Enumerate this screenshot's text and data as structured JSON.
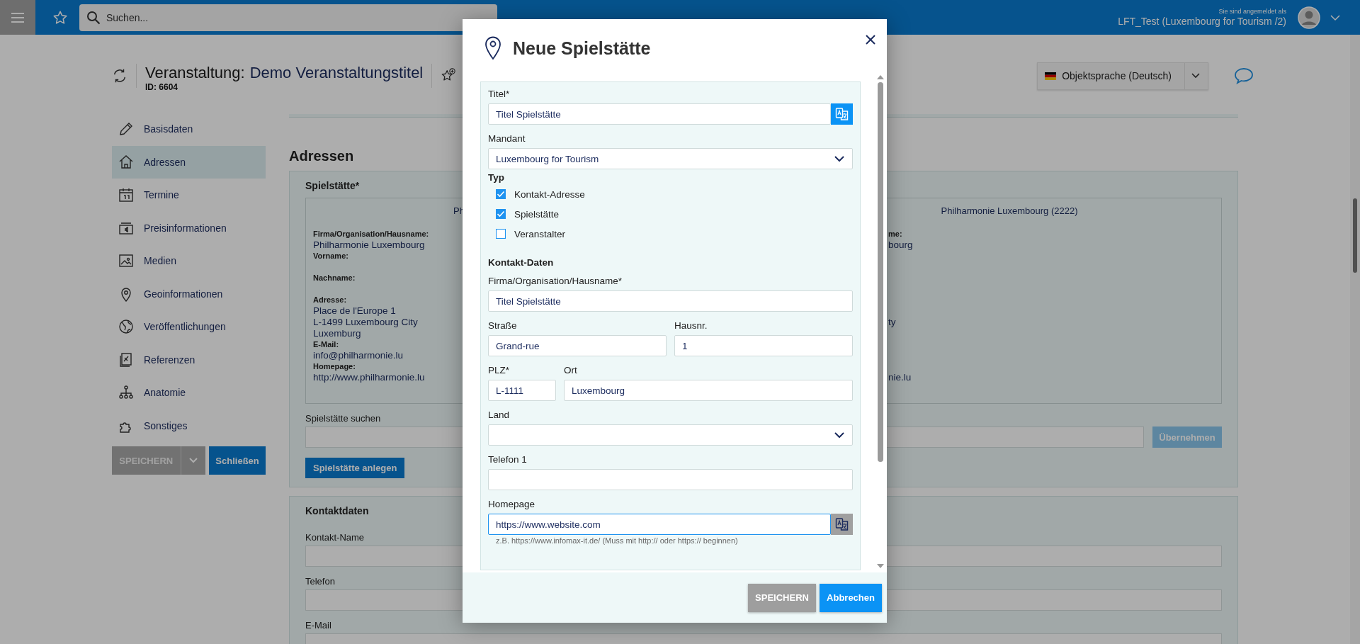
{
  "topbar": {
    "search": {
      "placeholder": "Suchen..."
    },
    "user": {
      "caption": "Sie sind angemeldet als",
      "name": "LFT_Test (Luxembourg for Tourism /2)"
    }
  },
  "header": {
    "prefix": "Veranstaltung:",
    "title": "Demo Veranstaltungstitel",
    "id": "ID: 6604",
    "language": "Objektsprache (Deutsch)"
  },
  "sidebar": {
    "items": [
      {
        "label": "Basisdaten",
        "selected": false
      },
      {
        "label": "Adressen",
        "selected": true
      },
      {
        "label": "Termine",
        "selected": false
      },
      {
        "label": "Preisinformationen",
        "selected": false
      },
      {
        "label": "Medien",
        "selected": false
      },
      {
        "label": "Geoinformationen",
        "selected": false
      },
      {
        "label": "Veröffentlichungen",
        "selected": false
      },
      {
        "label": "Referenzen",
        "selected": false
      },
      {
        "label": "Anatomie",
        "selected": false
      },
      {
        "label": "Sonstiges",
        "selected": false
      }
    ],
    "save": "SPEICHERN",
    "close": "Schließen"
  },
  "main": {
    "heading": "Adressen",
    "venue": {
      "title": "Spielstätte*",
      "left_header": "Ph",
      "right_header": "Philharmonie Luxembourg (2222)",
      "left": [
        {
          "label": "Firma/Organisation/Hausname:",
          "lines": [
            "Philharmonie Luxembourg"
          ]
        },
        {
          "label": "Vorname:"
        },
        {
          "label": "Nachname:"
        },
        {
          "label": "Adresse:",
          "lines": [
            "Place de l'Europe 1",
            "L-1499 Luxembourg City",
            "Luxemburg"
          ]
        },
        {
          "label": "E-Mail:",
          "lines": [
            "info@philharmonie.lu"
          ]
        },
        {
          "label": "Homepage:",
          "lines": [
            "http://www.philharmonie.lu"
          ]
        }
      ],
      "right": [
        {
          "label": "me:",
          "lines": [
            "bourg"
          ]
        },
        {
          "lines": [
            "ty"
          ]
        },
        {
          "lines": [
            "nie.lu"
          ]
        }
      ],
      "search_label": "Spielstätte suchen",
      "apply": {
        "label": "Übernehmen",
        "disabled": true
      },
      "create": "Spielstätte anlegen"
    },
    "contact": {
      "title": "Kontaktdaten",
      "fields": [
        "Kontakt-Name",
        "Telefon",
        "E-Mail"
      ]
    }
  },
  "modal": {
    "title": "Neue Spielstätte",
    "form": [
      {
        "kind": "text",
        "label": "Titel*",
        "value": "Titel Spielstätte",
        "translate": {
          "active": true
        }
      },
      {
        "kind": "select",
        "label": "Mandant",
        "value": "Luxembourg for Tourism"
      },
      {
        "kind": "checks",
        "label": "Typ",
        "options": [
          {
            "label": "Kontakt-Adresse",
            "checked": true
          },
          {
            "label": "Spielstätte",
            "checked": true
          },
          {
            "label": "Veranstalter",
            "checked": false
          }
        ]
      },
      {
        "kind": "heading",
        "label": "Kontakt-Daten"
      },
      {
        "kind": "text",
        "label": "Firma/Organisation/Hausname*",
        "value": "Titel Spielstätte"
      },
      {
        "kind": "pair",
        "fields": [
          {
            "label": "Straße",
            "value": "Grand-rue"
          },
          {
            "label": "Hausnr.",
            "value": "1"
          }
        ]
      },
      {
        "kind": "postal",
        "fields": [
          {
            "label": "PLZ*",
            "value": "L-1111"
          },
          {
            "label": "Ort",
            "value": "Luxembourg"
          }
        ]
      },
      {
        "kind": "select",
        "label": "Land"
      },
      {
        "kind": "text",
        "label": "Telefon 1"
      },
      {
        "kind": "text",
        "label": "Homepage",
        "value": "https://www.website.com",
        "focused": true,
        "translate": {
          "active": false
        },
        "hint": "z.B. https://www.infomax-it.de/ (Muss mit http:// oder https:// beginnen)"
      }
    ],
    "save": "SPEICHERN",
    "cancel": "Abbrechen"
  }
}
